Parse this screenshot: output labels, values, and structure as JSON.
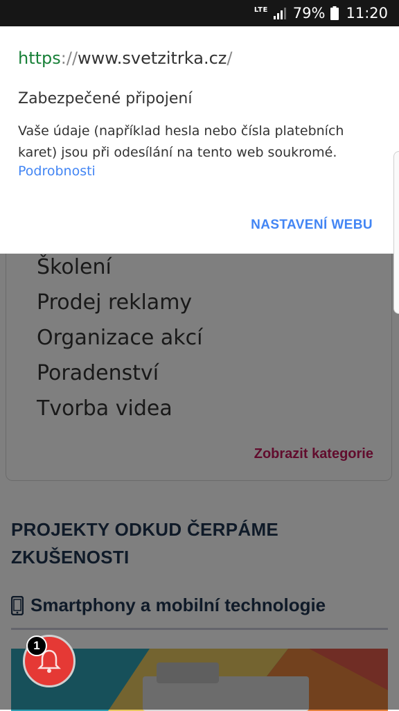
{
  "status_bar": {
    "network": "LTE",
    "battery_percent": "79%",
    "time": "11:20"
  },
  "popup": {
    "url": {
      "scheme": "https",
      "separator": "://",
      "host": "www.svetzitrka.cz",
      "path": "/"
    },
    "security_title": "Zabezpečené připojení",
    "security_description": "Vaše údaje (například hesla nebo čísla platebních karet) jsou při odesílání na tento web soukromé.",
    "details_link": "Podrobnosti",
    "site_settings_button": "NASTAVENÍ WEBU"
  },
  "page": {
    "categories": [
      "Školení",
      "Prodej reklamy",
      "Organizace akcí",
      "Poradenství",
      "Tvorba videa"
    ],
    "show_categories_link": "Zobrazit kategorie",
    "projects_heading": "PROJEKTY ODKUD ČERPÁME ZKUŠENOSTI",
    "section_title": "Smartphony a mobilní technologie"
  },
  "notification": {
    "badge_count": "1"
  },
  "colors": {
    "link_blue": "#4285f4",
    "secure_green": "#188038",
    "category_link": "#c2185b",
    "heading": "#1e3550",
    "bell_red": "#e53935"
  },
  "icons": [
    "lte-icon",
    "signal-icon",
    "battery-icon",
    "smartphone-icon",
    "bell-icon"
  ]
}
